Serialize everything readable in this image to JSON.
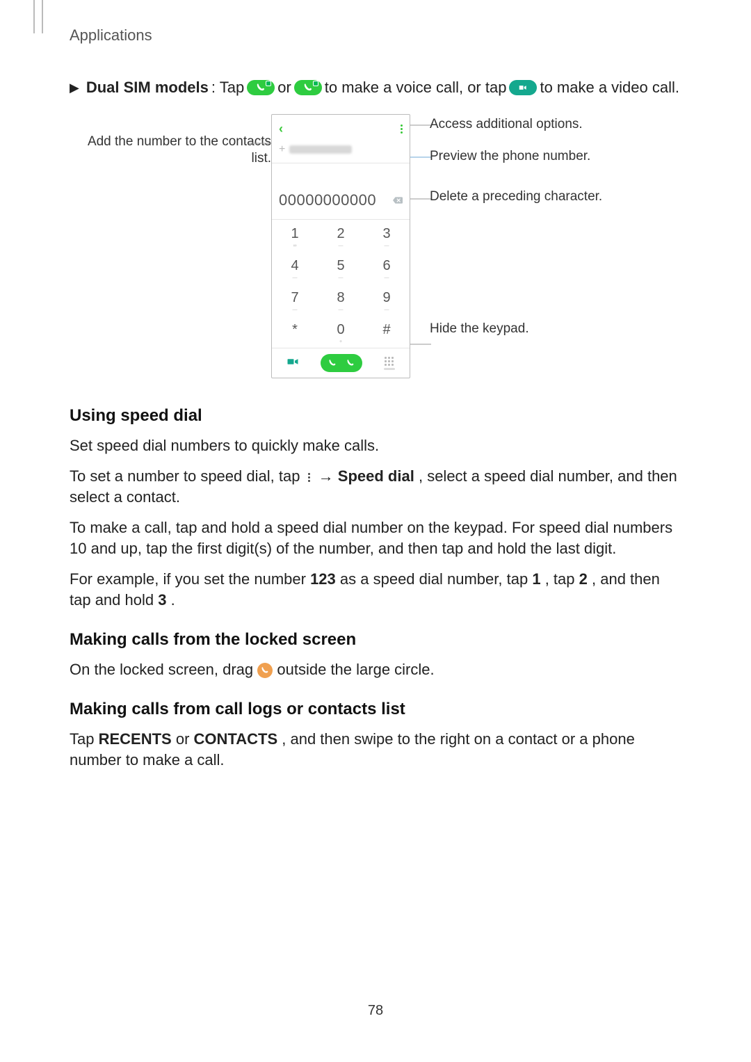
{
  "header": {
    "title": "Applications"
  },
  "dualsim": {
    "label": "Dual SIM models",
    "t1": ": Tap ",
    "t2": " or ",
    "t3": " to make a voice call, or tap ",
    "t4": " to make a video call."
  },
  "callouts": {
    "left": "Add the number to the contacts list.",
    "r1": "Access additional options.",
    "r2": "Preview the phone number.",
    "r3": "Delete a preceding character.",
    "r4": "Hide the keypad."
  },
  "phone": {
    "number": "00000000000",
    "keys": [
      "1",
      "2",
      "3",
      "4",
      "5",
      "6",
      "7",
      "8",
      "9",
      "*",
      "0",
      "#"
    ],
    "subs": [
      "∞",
      "—",
      "—",
      "—",
      "—",
      "—",
      "—",
      "—",
      "—",
      "",
      "+",
      ""
    ]
  },
  "sections": {
    "speed": {
      "h": "Using speed dial",
      "p1": "Set speed dial numbers to quickly make calls.",
      "p2a": "To set a number to speed dial, tap ",
      "p2b": " → ",
      "p2c": "Speed dial",
      "p2d": ", select a speed dial number, and then select a contact.",
      "p3": "To make a call, tap and hold a speed dial number on the keypad. For speed dial numbers 10 and up, tap the first digit(s) of the number, and then tap and hold the last digit.",
      "p4a": "For example, if you set the number ",
      "p4b": "123",
      "p4c": " as a speed dial number, tap ",
      "p4d": "1",
      "p4e": ", tap ",
      "p4f": "2",
      "p4g": ", and then tap and hold ",
      "p4h": "3",
      "p4i": "."
    },
    "locked": {
      "h": "Making calls from the locked screen",
      "p1a": "On the locked screen, drag ",
      "p1b": " outside the large circle."
    },
    "logs": {
      "h": "Making calls from call logs or contacts list",
      "p1a": "Tap ",
      "p1b": "RECENTS",
      "p1c": " or ",
      "p1d": "CONTACTS",
      "p1e": ", and then swipe to the right on a contact or a phone number to make a call."
    }
  },
  "page": "78"
}
